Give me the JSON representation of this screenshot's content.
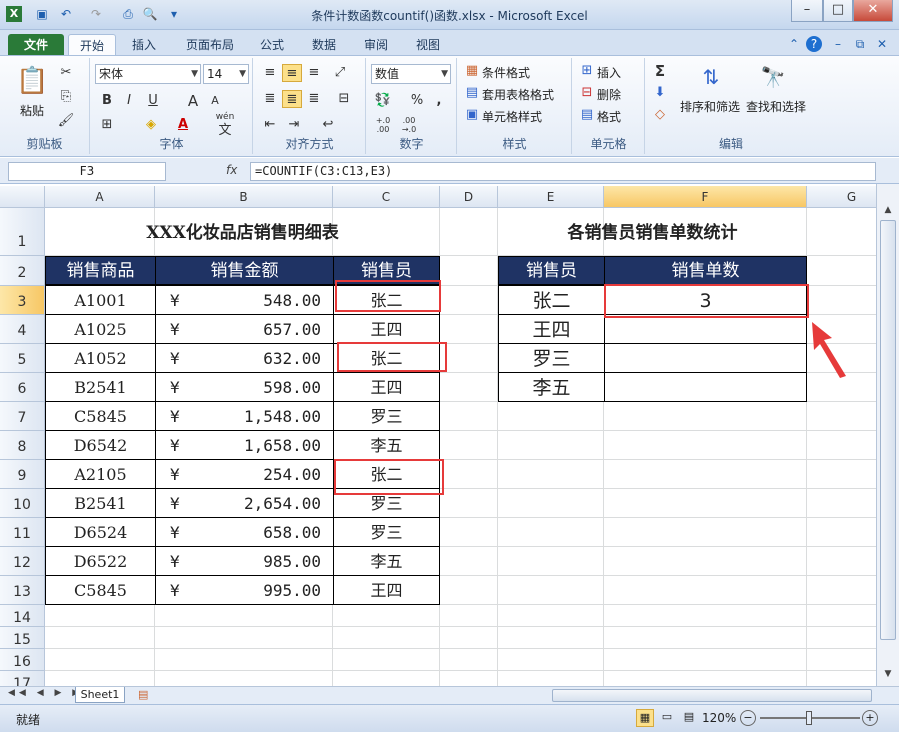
{
  "window": {
    "title": "条件计数函数countif()函数.xlsx - Microsoft Excel",
    "minimize": "–",
    "maximize": "□",
    "close": "✕"
  },
  "tabs": {
    "file": "文件",
    "items": [
      "开始",
      "插入",
      "页面布局",
      "公式",
      "数据",
      "审阅",
      "视图"
    ]
  },
  "ribbon": {
    "clipboard": {
      "label": "剪贴板",
      "paste": "粘贴"
    },
    "font": {
      "label": "字体",
      "family": "宋体",
      "size": "14",
      "bold": "B",
      "italic": "I",
      "underline": "U",
      "grow": "A",
      "shrink": "A",
      "color_a": "A",
      "wen": "wén",
      "wen2": "文"
    },
    "alignment": {
      "label": "对齐方式"
    },
    "number": {
      "label": "数字",
      "format": "数值",
      "percent": "%",
      "comma": ",",
      "dec_inc": "+.0\n.00",
      "dec_dec": ".00\n→.0"
    },
    "styles": {
      "label": "样式",
      "cond_format": "条件格式",
      "table_format": "套用表格格式",
      "cell_style": "单元格样式"
    },
    "cells": {
      "label": "单元格",
      "insert": "插入",
      "delete": "删除",
      "format": "格式"
    },
    "editing": {
      "label": "编辑",
      "sigma": "Σ",
      "sort": "排序和筛选",
      "find": "查找和选择"
    }
  },
  "formula_bar": {
    "name_box": "F3",
    "fx": "fx",
    "formula": "=COUNTIF(C3:C13,E3)"
  },
  "columns": [
    "A",
    "B",
    "C",
    "D",
    "E",
    "F",
    "G"
  ],
  "rows": [
    "1",
    "2",
    "3",
    "4",
    "5",
    "6",
    "7",
    "8",
    "9",
    "10",
    "11",
    "12",
    "13",
    "14",
    "15",
    "16",
    "17"
  ],
  "table1": {
    "title": "XXX化妆品店销售明细表",
    "headers": [
      "销售商品",
      "销售金额",
      "销售员"
    ],
    "currency": "¥",
    "rows": [
      {
        "product": "A1001",
        "amount": "548.00",
        "seller": "张二"
      },
      {
        "product": "A1025",
        "amount": "657.00",
        "seller": "王四"
      },
      {
        "product": "A1052",
        "amount": "632.00",
        "seller": "张二"
      },
      {
        "product": "B2541",
        "amount": "598.00",
        "seller": "王四"
      },
      {
        "product": "C5845",
        "amount": "1,548.00",
        "seller": "罗三"
      },
      {
        "product": "D6542",
        "amount": "1,658.00",
        "seller": "李五"
      },
      {
        "product": "A2105",
        "amount": "254.00",
        "seller": "张二"
      },
      {
        "product": "B2541",
        "amount": "2,654.00",
        "seller": "罗三"
      },
      {
        "product": "D6524",
        "amount": "658.00",
        "seller": "罗三"
      },
      {
        "product": "D6522",
        "amount": "985.00",
        "seller": "李五"
      },
      {
        "product": "C5845",
        "amount": "995.00",
        "seller": "王四"
      }
    ]
  },
  "table2": {
    "title": "各销售员销售单数统计",
    "headers": [
      "销售员",
      "销售单数"
    ],
    "rows": [
      {
        "seller": "张二",
        "count": "3"
      },
      {
        "seller": "王四",
        "count": ""
      },
      {
        "seller": "罗三",
        "count": ""
      },
      {
        "seller": "李五",
        "count": ""
      }
    ]
  },
  "status": {
    "ready": "就绪",
    "sheet": "Sheet1",
    "zoom": "120%"
  },
  "colors": {
    "header_fill": "#1f3364",
    "highlight": "#e63a3a",
    "file_tab": "#2a7a38"
  }
}
